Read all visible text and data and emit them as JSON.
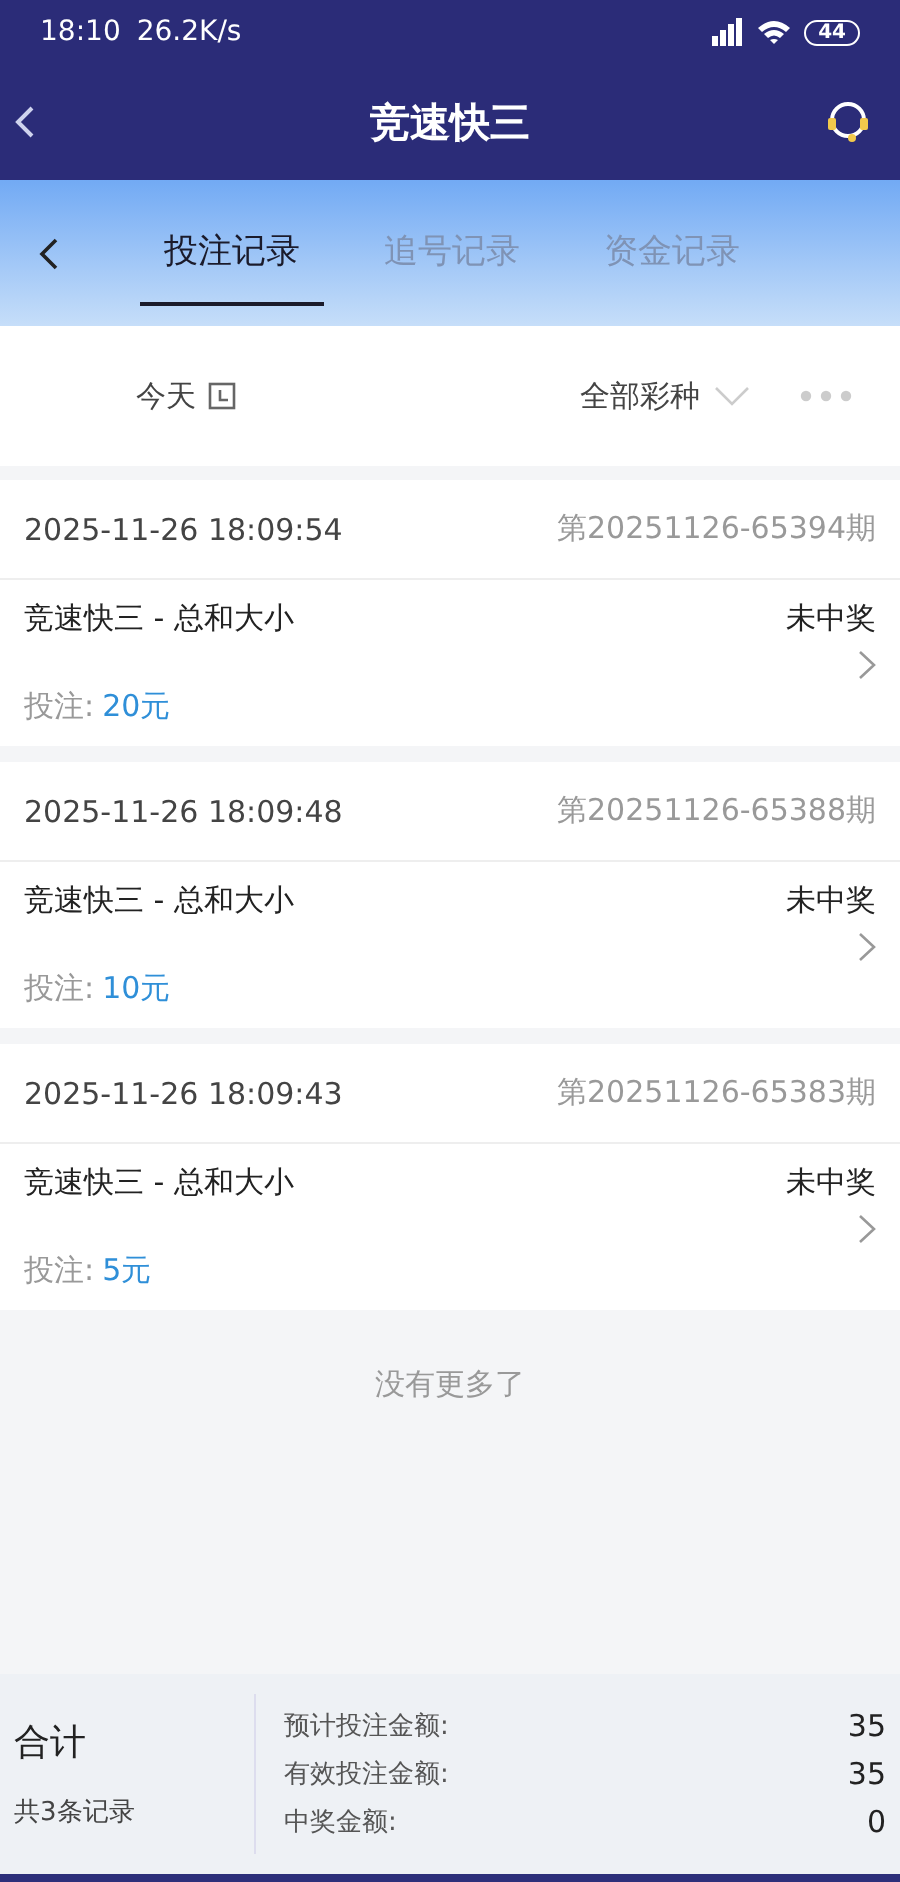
{
  "status_bar": {
    "time": "18:10",
    "speed": "26.2K/s",
    "battery": "44"
  },
  "header": {
    "title": "竞速快三"
  },
  "tabs": [
    {
      "label": "投注记录",
      "selected": true
    },
    {
      "label": "追号记录",
      "selected": false
    },
    {
      "label": "资金记录",
      "selected": false
    }
  ],
  "filters": {
    "date": "今天",
    "lottery": "全部彩种"
  },
  "records": [
    {
      "time": "2025-11-26 18:09:54",
      "issue": "第20251126-65394期",
      "game": "竞速快三 - 总和大小",
      "result": "未中奖",
      "bet_label": "投注:",
      "amount": "20元"
    },
    {
      "time": "2025-11-26 18:09:48",
      "issue": "第20251126-65388期",
      "game": "竞速快三 - 总和大小",
      "result": "未中奖",
      "bet_label": "投注:",
      "amount": "10元"
    },
    {
      "time": "2025-11-26 18:09:43",
      "issue": "第20251126-65383期",
      "game": "竞速快三 - 总和大小",
      "result": "未中奖",
      "bet_label": "投注:",
      "amount": "5元"
    }
  ],
  "end_note": "没有更多了",
  "summary": {
    "title": "合计",
    "count": "共3条记录",
    "rows": [
      {
        "label": "预计投注金额:",
        "value": "35"
      },
      {
        "label": "有效投注金额:",
        "value": "35"
      },
      {
        "label": "中奖金额:",
        "value": "0"
      }
    ]
  }
}
